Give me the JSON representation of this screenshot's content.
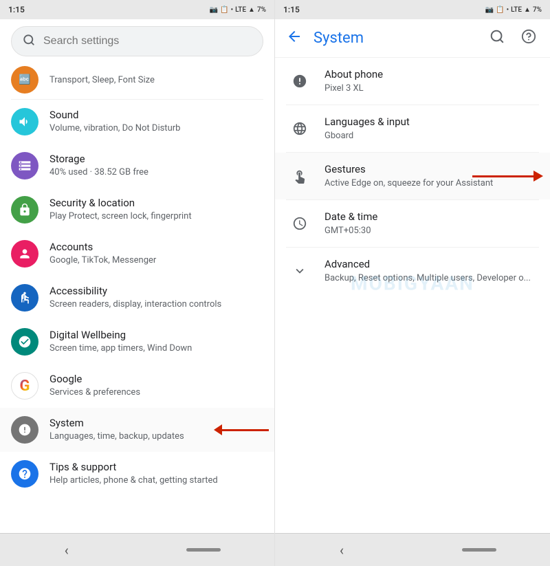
{
  "left_panel": {
    "status_bar": {
      "time": "1:15",
      "network": "LTE",
      "battery": "7%"
    },
    "search": {
      "placeholder": "Search settings"
    },
    "partial_item": {
      "label": "Transport, Sleep, Font Size",
      "icon_color": "orange"
    },
    "items": [
      {
        "id": "sound",
        "title": "Sound",
        "subtitle": "Volume, vibration, Do Not Disturb",
        "icon": "🔊",
        "icon_class": "ic-teal"
      },
      {
        "id": "storage",
        "title": "Storage",
        "subtitle": "40% used · 38.52 GB free",
        "icon": "≡",
        "icon_class": "ic-purple"
      },
      {
        "id": "security",
        "title": "Security & location",
        "subtitle": "Play Protect, screen lock, fingerprint",
        "icon": "🔒",
        "icon_class": "ic-green"
      },
      {
        "id": "accounts",
        "title": "Accounts",
        "subtitle": "Google, TikTok, Messenger",
        "icon": "👤",
        "icon_class": "ic-pink"
      },
      {
        "id": "accessibility",
        "title": "Accessibility",
        "subtitle": "Screen readers, display, interaction controls",
        "icon": "♿",
        "icon_class": "ic-blue-dark"
      },
      {
        "id": "digital",
        "title": "Digital Wellbeing",
        "subtitle": "Screen time, app timers, Wind Down",
        "icon": "⏱",
        "icon_class": "ic-green2"
      },
      {
        "id": "google",
        "title": "Google",
        "subtitle": "Services & preferences",
        "icon": "G",
        "icon_class": "ic-google"
      },
      {
        "id": "system",
        "title": "System",
        "subtitle": "Languages, time, backup, updates",
        "icon": "ℹ",
        "icon_class": "ic-gray",
        "has_arrow": true
      },
      {
        "id": "tips",
        "title": "Tips & support",
        "subtitle": "Help articles, phone & chat, getting started",
        "icon": "?",
        "icon_class": "ic-blue"
      }
    ],
    "nav_bar": {
      "back_label": "‹",
      "pill_label": ""
    }
  },
  "right_panel": {
    "status_bar": {
      "time": "1:15",
      "network": "LTE",
      "battery": "7%"
    },
    "header": {
      "title": "System",
      "back_icon": "←",
      "search_icon": "search",
      "help_icon": "help"
    },
    "items": [
      {
        "id": "about",
        "title": "About phone",
        "subtitle": "Pixel 3 XL",
        "icon": "ℹ",
        "icon_type": "circle"
      },
      {
        "id": "languages",
        "title": "Languages & input",
        "subtitle": "Gboard",
        "icon": "🌐",
        "icon_type": "globe"
      },
      {
        "id": "gestures",
        "title": "Gestures",
        "subtitle": "Active Edge on, squeeze for your Assistant",
        "icon": "✋",
        "icon_type": "gesture",
        "has_arrow": true
      },
      {
        "id": "datetime",
        "title": "Date & time",
        "subtitle": "GMT+05:30",
        "icon": "🕐",
        "icon_type": "clock"
      },
      {
        "id": "advanced",
        "title": "Advanced",
        "subtitle": "Backup, Reset options, Multiple users, Developer o...",
        "icon": "∨",
        "icon_type": "chevron"
      }
    ],
    "watermark": "MOBIGYAAN",
    "nav_bar": {
      "back_label": "‹",
      "pill_label": ""
    }
  }
}
